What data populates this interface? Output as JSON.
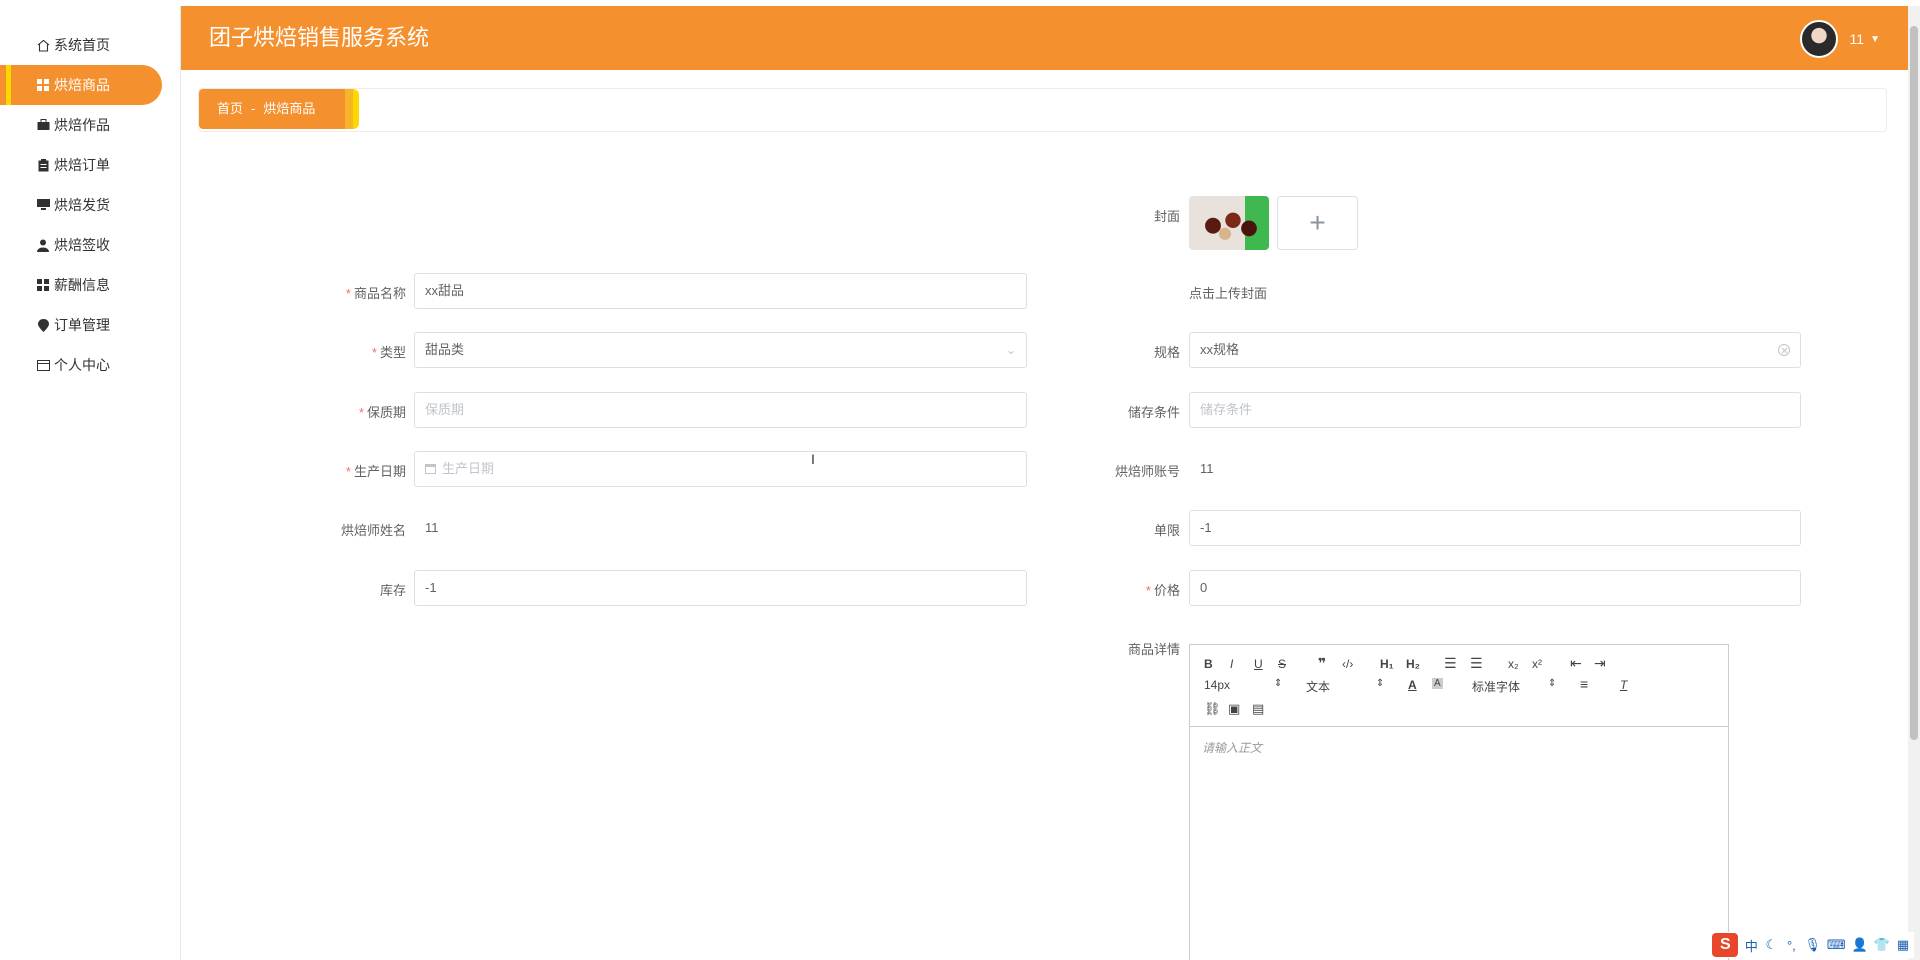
{
  "app": {
    "title": "团子烘焙销售服务系统",
    "user_name": "11"
  },
  "sidebar": {
    "items": [
      {
        "label": "系统首页",
        "icon": "home-icon"
      },
      {
        "label": "烘焙商品",
        "icon": "grid-icon",
        "active": true
      },
      {
        "label": "烘焙作品",
        "icon": "briefcase-icon"
      },
      {
        "label": "烘焙订单",
        "icon": "clipboard-icon"
      },
      {
        "label": "烘焙发货",
        "icon": "monitor-icon"
      },
      {
        "label": "烘焙签收",
        "icon": "user-icon"
      },
      {
        "label": "薪酬信息",
        "icon": "grid-icon"
      },
      {
        "label": "订单管理",
        "icon": "pin-icon"
      },
      {
        "label": "个人中心",
        "icon": "card-icon"
      }
    ]
  },
  "breadcrumb": {
    "home": "首页",
    "separator": "-",
    "current": "烘焙商品"
  },
  "form": {
    "cover": {
      "label": "封面",
      "hint": "点击上传封面",
      "add_symbol": "+"
    },
    "name": {
      "label": "商品名称",
      "value": "xx甜品",
      "required": true
    },
    "type": {
      "label": "类型",
      "value": "甜品类",
      "required": true
    },
    "spec": {
      "label": "规格",
      "value": "xx规格"
    },
    "shelf_life": {
      "label": "保质期",
      "placeholder": "保质期",
      "required": true
    },
    "storage": {
      "label": "储存条件",
      "placeholder": "储存条件"
    },
    "production_date": {
      "label": "生产日期",
      "placeholder": "生产日期",
      "required": true
    },
    "baker_account": {
      "label": "烘焙师账号",
      "value": "11"
    },
    "baker_name": {
      "label": "烘焙师姓名",
      "value": "11"
    },
    "limit": {
      "label": "单限",
      "value": "-1"
    },
    "stock": {
      "label": "库存",
      "value": "-1"
    },
    "price": {
      "label": "价格",
      "value": "0",
      "required": true
    },
    "detail": {
      "label": "商品详情",
      "placeholder": "请输入正文"
    }
  },
  "editor": {
    "font_size": "14px",
    "block_type": "文本",
    "font_family": "标准字体"
  },
  "colors": {
    "accent": "#f5902e",
    "accent_secondary": "#ffd600",
    "required": "#f56c6c"
  }
}
